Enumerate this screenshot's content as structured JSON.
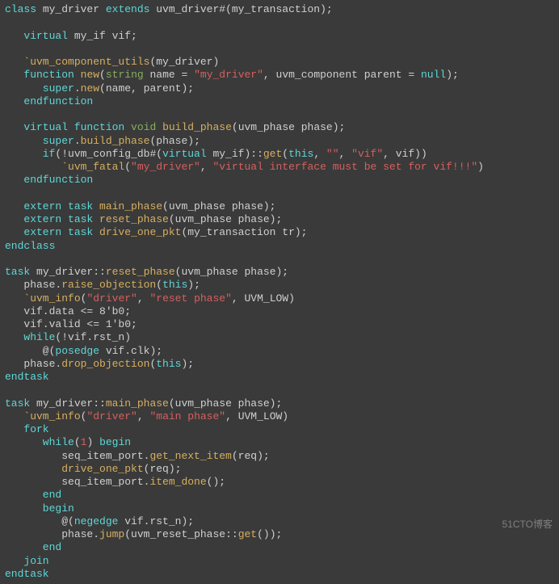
{
  "code": {
    "l01": {
      "a": "class",
      "b": " my_driver ",
      "c": "extends",
      "d": " uvm_driver#(my_transaction);"
    },
    "l02": "",
    "l03": {
      "a": "   virtual",
      "b": " my_if vif;"
    },
    "l04": "",
    "l05": {
      "a": "   `uvm_component_utils",
      "b": "(my_driver)"
    },
    "l06": {
      "a": "   function",
      "b": " ",
      "c": "new",
      "d": "(",
      "e": "string",
      "f": " name = ",
      "g": "\"my_driver\"",
      "h": ", uvm_component parent = ",
      "i": "null",
      "j": ");"
    },
    "l07": {
      "a": "      super",
      "b": ".",
      "c": "new",
      "d": "(name, parent);"
    },
    "l08": {
      "a": "   endfunction"
    },
    "l09": "",
    "l10": {
      "a": "   virtual function",
      "b": " ",
      "c": "void",
      "d": " ",
      "e": "build_phase",
      "f": "(uvm_phase phase);"
    },
    "l11": {
      "a": "      super",
      "b": ".",
      "c": "build_phase",
      "d": "(phase);"
    },
    "l12": {
      "a": "      if",
      "b": "(!uvm_config_db#(",
      "c": "virtual",
      "d": " my_if)::",
      "e": "get",
      "f": "(",
      "g": "this",
      "h": ", ",
      "i": "\"\"",
      "j": ", ",
      "k": "\"vif\"",
      "l": ", vif))"
    },
    "l13": {
      "a": "         `uvm_fatal",
      "b": "(",
      "c": "\"my_driver\"",
      "d": ", ",
      "e": "\"virtual interface must be set for vif!!!\"",
      "f": ")"
    },
    "l14": {
      "a": "   endfunction"
    },
    "l15": "",
    "l16": {
      "a": "   extern task",
      "b": " ",
      "c": "main_phase",
      "d": "(uvm_phase phase);"
    },
    "l17": {
      "a": "   extern task",
      "b": " ",
      "c": "reset_phase",
      "d": "(uvm_phase phase);"
    },
    "l18": {
      "a": "   extern task",
      "b": " ",
      "c": "drive_one_pkt",
      "d": "(my_transaction tr);"
    },
    "l19": {
      "a": "endclass"
    },
    "l20": "",
    "l21": {
      "a": "task",
      "b": " my_driver::",
      "c": "reset_phase",
      "d": "(uvm_phase phase);"
    },
    "l22": {
      "a": "   phase.",
      "b": "raise_objection",
      "c": "(",
      "d": "this",
      "e": ");"
    },
    "l23": {
      "a": "   `uvm_info",
      "b": "(",
      "c": "\"driver\"",
      "d": ", ",
      "e": "\"reset phase\"",
      "f": ", UVM_LOW)"
    },
    "l24": "   vif.data <= 8'b0;",
    "l25": "   vif.valid <= 1'b0;",
    "l26": {
      "a": "   while",
      "b": "(!vif.rst_n)"
    },
    "l27": {
      "a": "      @(",
      "b": "posedge",
      "c": " vif.clk);"
    },
    "l28": {
      "a": "   phase.",
      "b": "drop_objection",
      "c": "(",
      "d": "this",
      "e": ");"
    },
    "l29": {
      "a": "endtask"
    },
    "l30": "",
    "l31": {
      "a": "task",
      "b": " my_driver::",
      "c": "main_phase",
      "d": "(uvm_phase phase);"
    },
    "l32": {
      "a": "   `uvm_info",
      "b": "(",
      "c": "\"driver\"",
      "d": ", ",
      "e": "\"main phase\"",
      "f": ", UVM_LOW)"
    },
    "l33": {
      "a": "   fork"
    },
    "l34": {
      "a": "      while",
      "b": "(",
      "c": "1",
      "d": ") ",
      "e": "begin"
    },
    "l35": {
      "a": "         seq_item_port.",
      "b": "get_next_item",
      "c": "(req);"
    },
    "l36": {
      "a": "         ",
      "b": "drive_one_pkt",
      "c": "(req);"
    },
    "l37": {
      "a": "         seq_item_port.",
      "b": "item_done",
      "c": "();"
    },
    "l38": {
      "a": "      end"
    },
    "l39": {
      "a": "      begin"
    },
    "l40": {
      "a": "         @(",
      "b": "negedge",
      "c": " vif.rst_n);"
    },
    "l41": {
      "a": "         phase.",
      "b": "jump",
      "c": "(uvm_reset_phase::",
      "d": "get",
      "e": "());"
    },
    "l42": {
      "a": "      end"
    },
    "l43": {
      "a": "   join"
    },
    "l44": {
      "a": "endtask"
    }
  },
  "watermark": "51CTO博客"
}
